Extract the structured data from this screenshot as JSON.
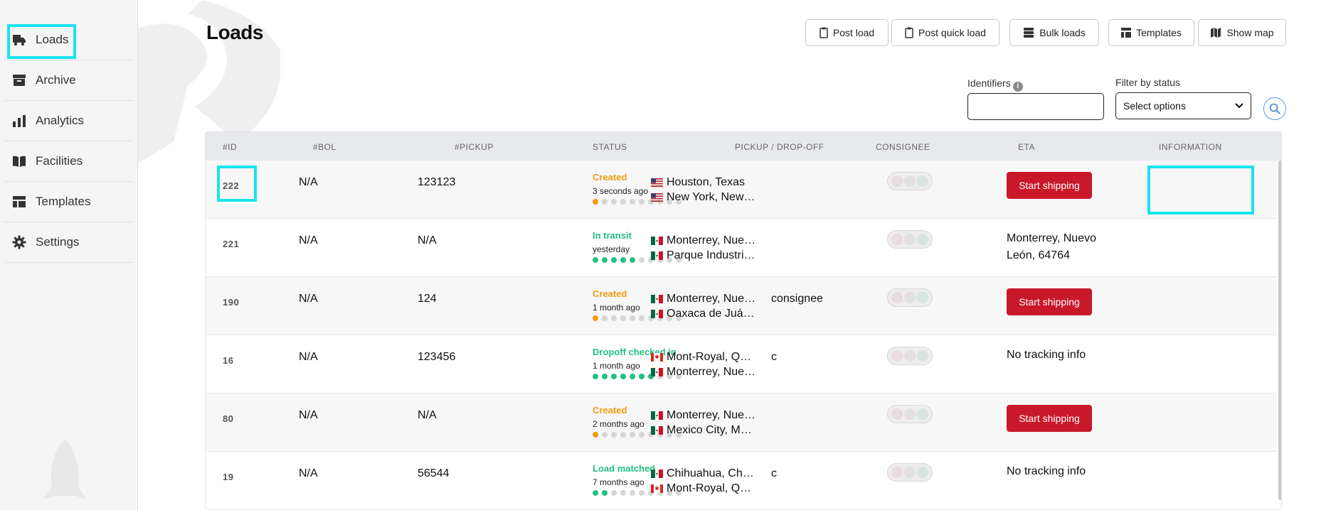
{
  "sidebar": {
    "items": [
      {
        "label": "Loads",
        "icon": "truck-icon"
      },
      {
        "label": "Archive",
        "icon": "archive-icon"
      },
      {
        "label": "Analytics",
        "icon": "bar-chart-icon"
      },
      {
        "label": "Facilities",
        "icon": "book-icon"
      },
      {
        "label": "Templates",
        "icon": "layout-icon"
      },
      {
        "label": "Settings",
        "icon": "gear-icon"
      }
    ]
  },
  "page": {
    "title": "Loads"
  },
  "toolbar": {
    "post_load": "Post load",
    "post_quick_load": "Post quick load",
    "bulk_loads": "Bulk loads",
    "templates": "Templates",
    "show_map": "Show map"
  },
  "filters": {
    "identifiers_label": "Identifiers",
    "identifiers_value": "",
    "status_label": "Filter by status",
    "status_placeholder": "Select options"
  },
  "table": {
    "headers": [
      "#ID",
      "#BOL",
      "#PICKUP",
      "STATUS",
      "PICKUP / DROP-OFF",
      "CONSIGNEE",
      "ETA",
      "INFORMATION"
    ],
    "rows": [
      {
        "id": "222",
        "bol": "N/A",
        "pickup": "123123",
        "status": "Created",
        "time": "3 seconds ago",
        "pickup_loc": "Houston, Texas",
        "dropoff_loc": "New York, New…",
        "consignee": "",
        "info": "Start shipping"
      },
      {
        "id": "221",
        "bol": "N/A",
        "pickup": "N/A",
        "status": "In transit",
        "time": "yesterday",
        "pickup_loc": "Monterrey, Nue…",
        "dropoff_loc": "Parque Industri…",
        "consignee": "",
        "info": "Monterrey, Nuevo León, 64764"
      },
      {
        "id": "190",
        "bol": "N/A",
        "pickup": "124",
        "status": "Created",
        "time": "1 month ago",
        "pickup_loc": "Monterrey, Nue…",
        "dropoff_loc": "Oaxaca de Juá…",
        "consignee": "consignee",
        "info": "Start shipping"
      },
      {
        "id": "16",
        "bol": "N/A",
        "pickup": "123456",
        "status": "Dropoff checked in",
        "time": "1 month ago",
        "pickup_loc": "Mont-Royal, Q…",
        "dropoff_loc": "Monterrey, Nue…",
        "consignee": "c",
        "info": "No tracking info"
      },
      {
        "id": "80",
        "bol": "N/A",
        "pickup": "N/A",
        "status": "Created",
        "time": "2 months ago",
        "pickup_loc": "Monterrey, Nue…",
        "dropoff_loc": "Mexico City, M…",
        "consignee": "",
        "info": "Start shipping"
      },
      {
        "id": "19",
        "bol": "N/A",
        "pickup": "56544",
        "status": "Load matched",
        "time": "7 months ago",
        "pickup_loc": "Chihuahua, Ch…",
        "dropoff_loc": "Mont-Royal, Q…",
        "consignee": "c",
        "info": "No tracking info"
      }
    ]
  },
  "colors": {
    "created": "#f29a0f",
    "green": "#22c081",
    "danger": "#c8182a",
    "highlight": "#19e3f0"
  }
}
